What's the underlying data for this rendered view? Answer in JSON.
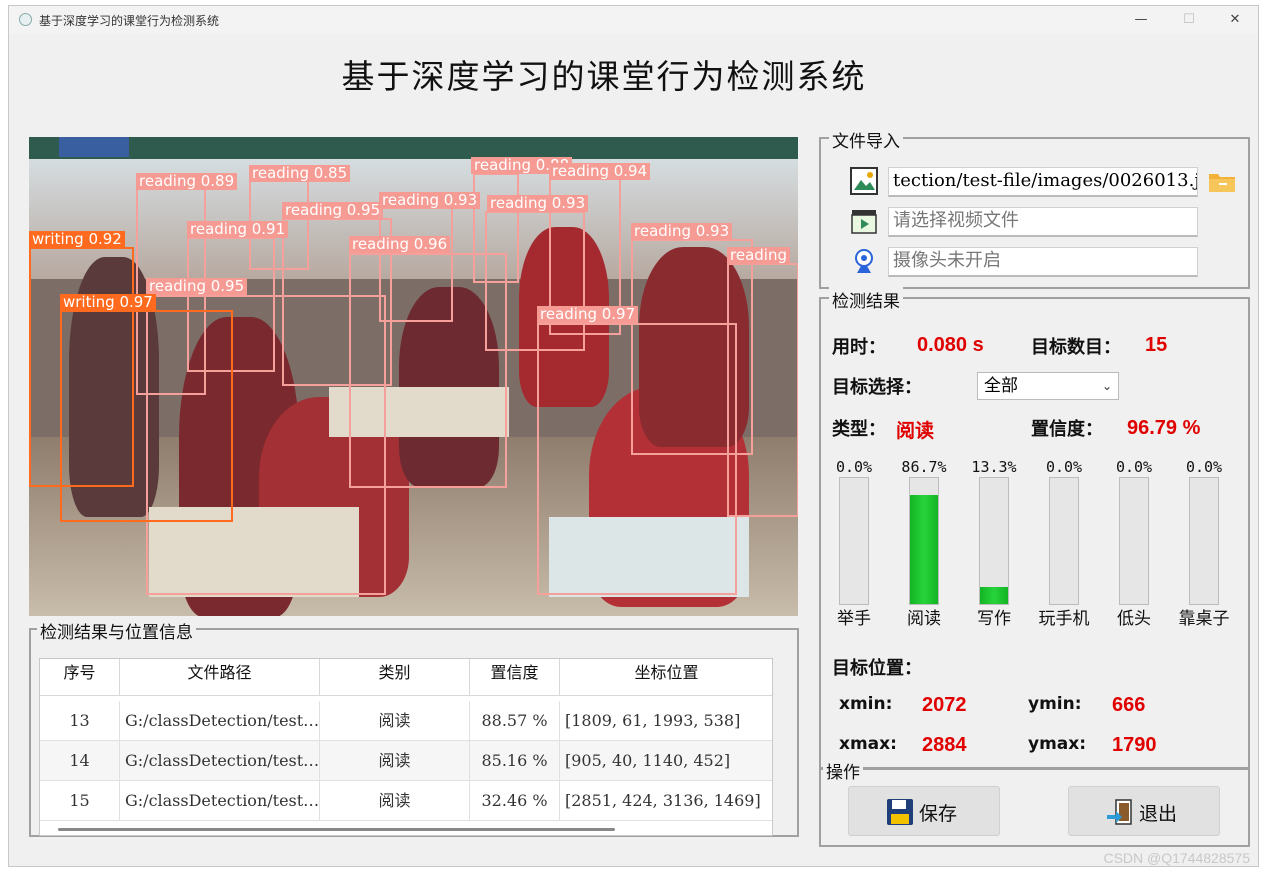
{
  "window": {
    "title": "基于深度学习的课堂行为检测系统",
    "minimize": "—",
    "maximize": "☐",
    "close": "✕"
  },
  "main_title": "基于深度学习的课堂行为检测系统",
  "detections_overlay": [
    {
      "label": "reading 0.89",
      "kind": "reading"
    },
    {
      "label": "reading 0.85",
      "kind": "reading"
    },
    {
      "label": "reading 0.88",
      "kind": "reading"
    },
    {
      "label": "reading 0.94",
      "kind": "reading"
    },
    {
      "label": "reading 0.95",
      "kind": "reading"
    },
    {
      "label": "reading 0.93",
      "kind": "reading"
    },
    {
      "label": "reading 0.93",
      "kind": "reading"
    },
    {
      "label": "reading 0.91",
      "kind": "reading"
    },
    {
      "label": "writing 0.92",
      "kind": "writing"
    },
    {
      "label": "reading 0.96",
      "kind": "reading"
    },
    {
      "label": "reading 0.93",
      "kind": "reading"
    },
    {
      "label": "reading",
      "kind": "reading"
    },
    {
      "label": "reading 0.95",
      "kind": "reading"
    },
    {
      "label": "writing 0.97",
      "kind": "writing"
    },
    {
      "label": "reading 0.97",
      "kind": "reading"
    }
  ],
  "file_import": {
    "title": "文件导入",
    "image_path": "tection/test-file/images/0026013.jpg",
    "video_placeholder": "请选择视频文件",
    "camera_placeholder": "摄像头未开启",
    "image_icon": "image-icon",
    "folder_icon": "folder-icon",
    "video_icon": "video-icon",
    "camera_icon": "webcam-icon"
  },
  "results": {
    "title": "检测结果",
    "time_label": "用时：",
    "time_value": "0.080 s",
    "count_label": "目标数目：",
    "count_value": "15",
    "select_label": "目标选择：",
    "select_value": "全部",
    "type_label": "类型：",
    "type_value": "阅读",
    "conf_label": "置信度：",
    "conf_value": "96.79 %",
    "bars": [
      {
        "name": "举手",
        "pct_text": "0.0%",
        "value": 0.0
      },
      {
        "name": "阅读",
        "pct_text": "86.7%",
        "value": 86.7
      },
      {
        "name": "写作",
        "pct_text": "13.3%",
        "value": 13.3
      },
      {
        "name": "玩手机",
        "pct_text": "0.0%",
        "value": 0.0
      },
      {
        "name": "低头",
        "pct_text": "0.0%",
        "value": 0.0
      },
      {
        "name": "靠桌子",
        "pct_text": "0.0%",
        "value": 0.0
      }
    ],
    "pos_label": "目标位置：",
    "xmin_label": "xmin:",
    "xmin_value": "2072",
    "ymin_label": "ymin:",
    "ymin_value": "666",
    "xmax_label": "xmax:",
    "xmax_value": "2884",
    "ymax_label": "ymax:",
    "ymax_value": "1790"
  },
  "ops": {
    "title": "操作",
    "save_label": "保存",
    "exit_label": "退出",
    "save_icon": "save-icon",
    "exit_icon": "exit-icon"
  },
  "table": {
    "title": "检测结果与位置信息",
    "headers": [
      "序号",
      "文件路径",
      "类别",
      "置信度",
      "坐标位置"
    ],
    "rows": [
      {
        "id": "13",
        "path": "G:/classDetection/test…",
        "cls": "阅读",
        "conf": "88.57 %",
        "pos": "[1809, 61, 1993, 538]"
      },
      {
        "id": "14",
        "path": "G:/classDetection/test…",
        "cls": "阅读",
        "conf": "85.16 %",
        "pos": "[905, 40, 1140, 452]"
      },
      {
        "id": "15",
        "path": "G:/classDetection/test…",
        "cls": "阅读",
        "conf": "32.46 %",
        "pos": "[2851, 424, 3136, 1469]"
      }
    ]
  },
  "watermark": "CSDN @Q1744828575"
}
